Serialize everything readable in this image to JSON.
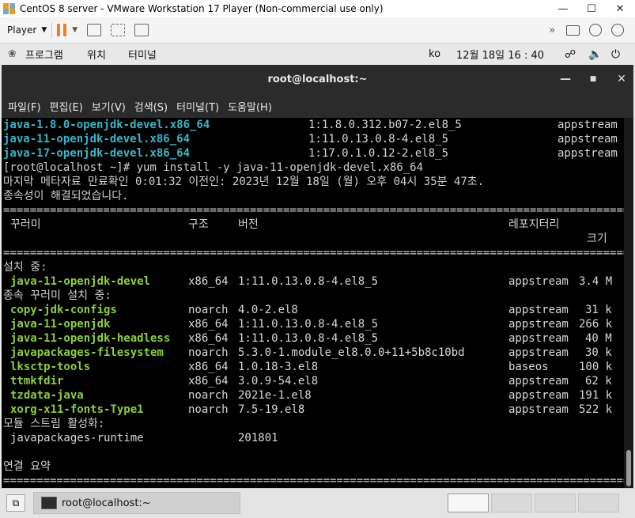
{
  "vmware": {
    "title": "CentOS 8 server - VMware Workstation 17 Player (Non-commercial use only)",
    "player_menu_label": "Player",
    "icons": [
      "vmware-logo-icon",
      "pause-icon",
      "send-ctrl-alt-del-icon",
      "fit-window-icon",
      "unity-icon",
      "forward-icon",
      "hard-disk-icon",
      "cd-icon",
      "network-icon"
    ]
  },
  "gnome_top": {
    "activities": "프로그램",
    "places": "위치",
    "app_menu": "터미널",
    "input_method": "ko",
    "clock": "12월 18일  16 : 40"
  },
  "terminal": {
    "window_title": "root@localhost:~",
    "menu": [
      "파일(F)",
      "편집(E)",
      "보기(V)",
      "검색(S)",
      "터미널(T)",
      "도움말(H)"
    ],
    "search_results": [
      {
        "pkg": "java-1.8.0-openjdk-devel.x86_64",
        "ver": "1:1.8.0.312.b07-2.el8_5",
        "repo": "appstream"
      },
      {
        "pkg": "java-11-openjdk-devel.x86_64",
        "ver": "1:11.0.13.0.8-4.el8_5",
        "repo": "appstream"
      },
      {
        "pkg": "java-17-openjdk-devel.x86_64",
        "ver": "1:17.0.1.0.12-2.el8_5",
        "repo": "appstream"
      }
    ],
    "prompt_line": "[root@localhost ~]# yum install -y java-11-openjdk-devel.x86_64",
    "metadata_line": "마지막 메타자료 만료확인 0:01:32 이전인: 2023년 12월 18일 (월) 오후 04시 35분 47초.",
    "deps_resolved": "종속성이 해결되었습니다.",
    "separator": "================================================================================================================",
    "header": {
      "package": "꾸러미",
      "arch": "구조",
      "version": "버전",
      "repository": "레포지터리",
      "size": "크기"
    },
    "installing_label": "설치 중:",
    "installing": [
      {
        "pkg": "java-11-openjdk-devel",
        "arch": "x86_64",
        "ver": "1:11.0.13.0.8-4.el8_5",
        "repo": "appstream",
        "size": "3.4 M"
      }
    ],
    "deps_label": "종속 꾸러미 설치 중:",
    "deps": [
      {
        "pkg": "copy-jdk-configs",
        "arch": "noarch",
        "ver": "4.0-2.el8",
        "repo": "appstream",
        "size": "31 k"
      },
      {
        "pkg": "java-11-openjdk",
        "arch": "x86_64",
        "ver": "1:11.0.13.0.8-4.el8_5",
        "repo": "appstream",
        "size": "266 k"
      },
      {
        "pkg": "java-11-openjdk-headless",
        "arch": "x86_64",
        "ver": "1:11.0.13.0.8-4.el8_5",
        "repo": "appstream",
        "size": "40 M"
      },
      {
        "pkg": "javapackages-filesystem",
        "arch": "noarch",
        "ver": "5.3.0-1.module_el8.0.0+11+5b8c10bd",
        "repo": "appstream",
        "size": "30 k"
      },
      {
        "pkg": "lksctp-tools",
        "arch": "x86_64",
        "ver": "1.0.18-3.el8",
        "repo": "baseos",
        "size": "100 k"
      },
      {
        "pkg": "ttmkfdir",
        "arch": "x86_64",
        "ver": "3.0.9-54.el8",
        "repo": "appstream",
        "size": "62 k"
      },
      {
        "pkg": "tzdata-java",
        "arch": "noarch",
        "ver": "2021e-1.el8",
        "repo": "appstream",
        "size": "191 k"
      },
      {
        "pkg": "xorg-x11-fonts-Type1",
        "arch": "noarch",
        "ver": "7.5-19.el8",
        "repo": "appstream",
        "size": "522 k"
      }
    ],
    "module_label": "모듈 스트림 활성화:",
    "modules": [
      {
        "name": "javapackages-runtime",
        "stream": "201801"
      }
    ],
    "summary_label": "연결 요약"
  },
  "taskbar": {
    "task_label": "root@localhost:~"
  },
  "colors": {
    "cyan": "#35b7c7",
    "green": "#8ccf3a",
    "accent_orange": "#f07e20"
  }
}
